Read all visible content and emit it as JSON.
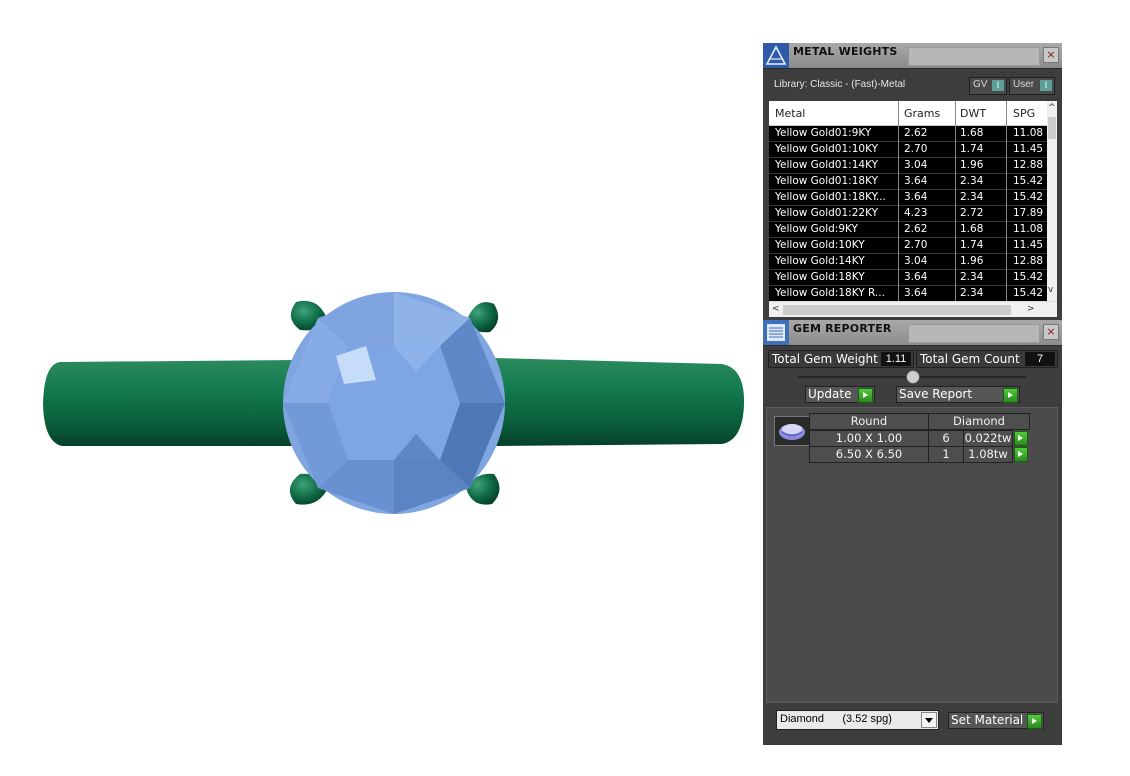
{
  "metal_weights": {
    "title": "METAL WEIGHTS",
    "library_label": "Library: Classic - (Fast)-Metal",
    "toggle_gv": "GV",
    "toggle_user": "User",
    "toggle_value": "I",
    "close": "×",
    "columns": [
      "Metal",
      "Grams",
      "DWT",
      "SPG"
    ],
    "rows": [
      [
        "Yellow Gold01:9KY",
        "2.62",
        "1.68",
        "11.08"
      ],
      [
        "Yellow Gold01:10KY",
        "2.70",
        "1.74",
        "11.45"
      ],
      [
        "Yellow Gold01:14KY",
        "3.04",
        "1.96",
        "12.88"
      ],
      [
        "Yellow Gold01:18KY",
        "3.64",
        "2.34",
        "15.42"
      ],
      [
        "Yellow Gold01:18KY...",
        "3.64",
        "2.34",
        "15.42"
      ],
      [
        "Yellow Gold01:22KY",
        "4.23",
        "2.72",
        "17.89"
      ],
      [
        "Yellow Gold:9KY",
        "2.62",
        "1.68",
        "11.08"
      ],
      [
        "Yellow Gold:10KY",
        "2.70",
        "1.74",
        "11.45"
      ],
      [
        "Yellow Gold:14KY",
        "3.04",
        "1.96",
        "12.88"
      ],
      [
        "Yellow Gold:18KY",
        "3.64",
        "2.34",
        "15.42"
      ],
      [
        "Yellow Gold:18KY R...",
        "3.64",
        "2.34",
        "15.42"
      ]
    ],
    "scroll_up": "^",
    "scroll_down": "v",
    "scroll_left": "<",
    "scroll_right": ">"
  },
  "gem_reporter": {
    "title": "GEM REPORTER",
    "close": "×",
    "total_weight_label": "Total Gem Weight",
    "total_weight_value": "1.11",
    "total_count_label": "Total Gem Count",
    "total_count_value": "7",
    "update_label": "Update",
    "save_label": "Save Report",
    "group_shape": "Round",
    "group_material": "Diamond",
    "gems": [
      {
        "size": "1.00 X 1.00",
        "count": "6",
        "weight": "0.022tw"
      },
      {
        "size": "6.50 X 6.50",
        "count": "1",
        "weight": "1.08tw"
      }
    ],
    "material_select": "Diamond      (3.52 spg)",
    "set_material_label": "Set Material"
  },
  "colors": {
    "metal": "#0b6a45",
    "gem": "#7fa6e0",
    "panel": "#3d3d3d",
    "accent_green": "#3cb62a"
  }
}
